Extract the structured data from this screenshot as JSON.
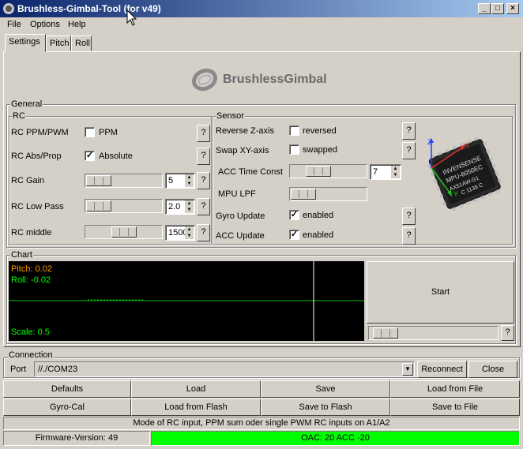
{
  "window": {
    "title": "Brushless-Gimbal-Tool (for v49)"
  },
  "menu": [
    "File",
    "Options",
    "Help"
  ],
  "tabs": [
    "Settings",
    "Pitch",
    "Roll"
  ],
  "logo": {
    "text": "BrushlessGimbal"
  },
  "general": {
    "label": "General",
    "rc": {
      "label": "RC",
      "rows": [
        {
          "label": "RC PPM/PWM",
          "control": "checkbox",
          "checked": false,
          "check_label": "PPM",
          "help": "?"
        },
        {
          "label": "RC Abs/Prop",
          "control": "checkbox",
          "checked": true,
          "check_label": "Absolute",
          "help": "?"
        },
        {
          "label": "RC Gain",
          "control": "slider",
          "value": "5",
          "help": "?"
        },
        {
          "label": "RC Low Pass",
          "control": "slider",
          "value": "2.0",
          "help": "?"
        },
        {
          "label": "RC middle",
          "control": "slider",
          "value": "1500",
          "help": "?"
        }
      ]
    },
    "sensor": {
      "label": "Sensor",
      "rows": [
        {
          "label": "Reverse Z-axis",
          "control": "checkbox",
          "checked": false,
          "check_label": "reversed",
          "help": "?"
        },
        {
          "label": "Swap XY-axis",
          "control": "checkbox",
          "checked": false,
          "check_label": "swapped",
          "help": "?"
        },
        {
          "label": "ACC Time Const",
          "control": "slider",
          "value": "7"
        },
        {
          "label": "MPU LPF",
          "control": "slider"
        },
        {
          "label": "Gyro Update",
          "control": "checkbox",
          "checked": true,
          "check_label": "enabled",
          "help": "?"
        },
        {
          "label": "ACC Update",
          "control": "checkbox",
          "checked": true,
          "check_label": "enabled",
          "help": "?"
        }
      ],
      "chip": {
        "line1": "INVENSENSE",
        "line2": "MPU-6050EC",
        "line3": "AX51AW-G1",
        "line4": "C 1138 C",
        "axis_x": "X",
        "axis_y": "Y",
        "axis_z": "Z"
      }
    }
  },
  "chart": {
    "label": "Chart",
    "pitch": "Pitch: 0.02",
    "roll": "Roll:  -0.02",
    "scale": "Scale:  0.5",
    "start_button": "Start",
    "help": "?",
    "colors": {
      "pitch": "#ff9900",
      "roll": "#00ff00",
      "scale": "#00ff00",
      "cursor": "#ffffff"
    }
  },
  "connection": {
    "label": "Connection",
    "port_label": "Port",
    "port_value": "//./COM23",
    "reconnect": "Reconnect",
    "close": "Close"
  },
  "buttons": {
    "row1": [
      "Defaults",
      "Load",
      "Save",
      "Load from File"
    ],
    "row2": [
      "Gyro-Cal",
      "Load from Flash",
      "Save to Flash",
      "Save to File"
    ]
  },
  "status": {
    "message": "Mode of RC input, PPM sum oder single PWM RC inputs on A1/A2",
    "firmware": "Firmware-Version: 49",
    "oac": "OAC: 20 ACC -20",
    "oac_color": "#00ff00"
  }
}
